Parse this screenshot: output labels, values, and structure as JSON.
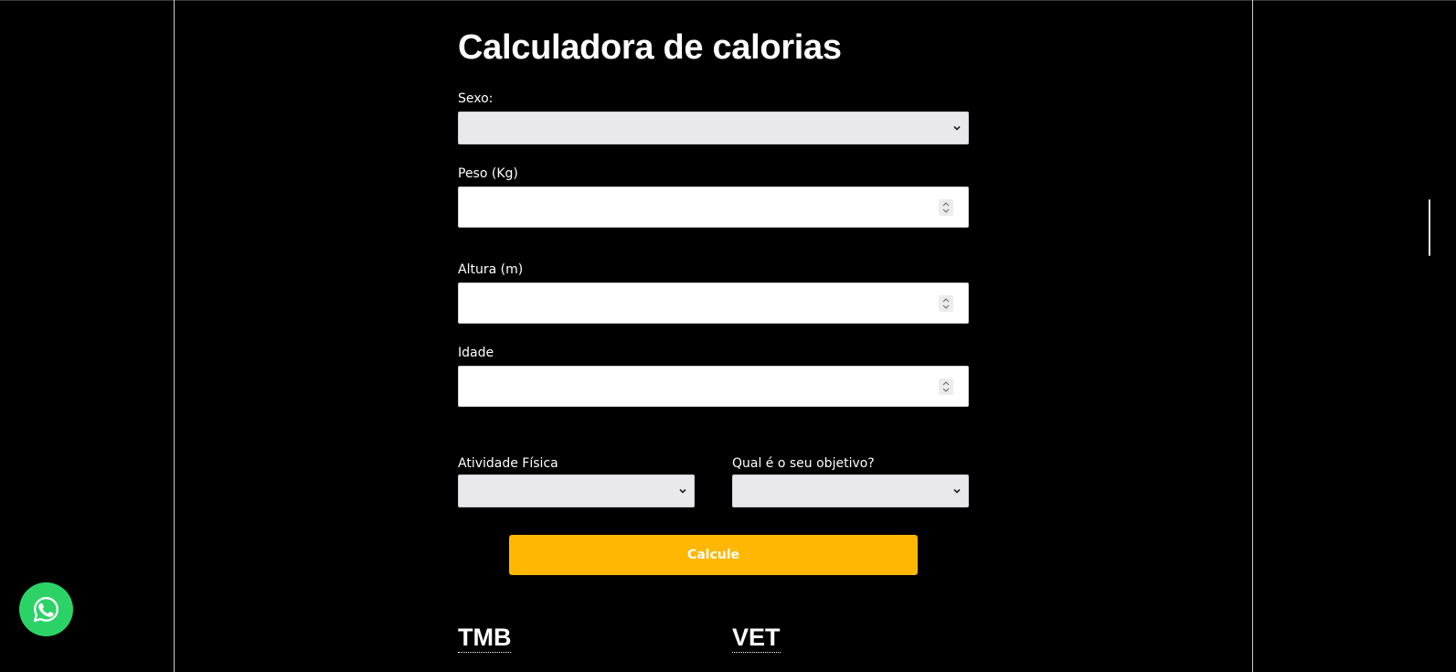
{
  "page": {
    "title": "Calculadora de calorias"
  },
  "form": {
    "sex_label": "Sexo:",
    "sex_value": "",
    "weight_label": "Peso (Kg)",
    "weight_value": "",
    "height_label": "Altura (m)",
    "height_value": "",
    "age_label": "Idade",
    "age_value": "",
    "activity_label": "Atividade Física",
    "activity_value": "",
    "goal_label": "Qual é o seu objetivo?",
    "goal_value": "",
    "submit_label": "Calcule"
  },
  "results": {
    "tmb_heading": "TMB",
    "vet_heading": "VET"
  },
  "icons": {
    "select_arrow": "chevron-down-icon",
    "number_spinner": "spinner-arrows-icon",
    "whatsapp": "whatsapp-icon"
  },
  "colors": {
    "background": "#000000",
    "accent_button": "#ffb703",
    "select_background": "#e8e8ed",
    "whatsapp_green": "#2bd366"
  }
}
